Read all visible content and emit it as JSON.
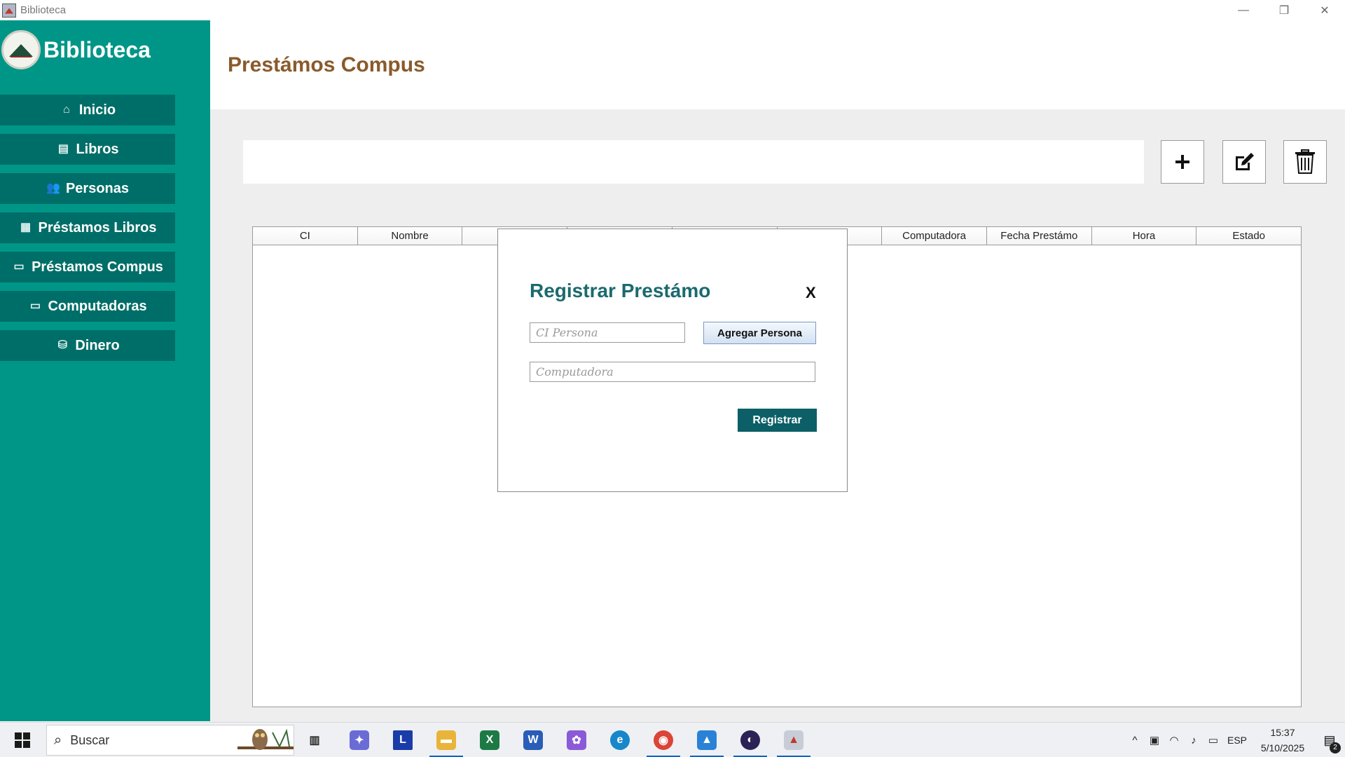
{
  "window": {
    "title": "Biblioteca",
    "minimize": "—",
    "maximize": "❐",
    "close": "✕"
  },
  "sidebar": {
    "brand": "Biblioteca",
    "items": [
      {
        "label": "Inicio",
        "icon": "⌂"
      },
      {
        "label": "Libros",
        "icon": "▤"
      },
      {
        "label": "Personas",
        "icon": "👥"
      },
      {
        "label": "Préstamos Libros",
        "icon": "▦"
      },
      {
        "label": "Préstamos Compus",
        "icon": "▭"
      },
      {
        "label": "Computadoras",
        "icon": "▭"
      },
      {
        "label": "Dinero",
        "icon": "⛁"
      }
    ]
  },
  "header": {
    "title": "Prestámos Compus"
  },
  "toolbar": {
    "search_value": "",
    "add": "+"
  },
  "table": {
    "columns": [
      "CI",
      "Nombre",
      "",
      "",
      "",
      "",
      "Computadora",
      "Fecha Prestámo",
      "Hora",
      "Estado"
    ]
  },
  "modal": {
    "title": "Registrar Prestámo",
    "close": "X",
    "ci_placeholder": "CI Persona",
    "ci_value": "",
    "computer_placeholder": "Computadora",
    "computer_value": "",
    "add_person": "Agregar Persona",
    "submit": "Registrar"
  },
  "taskbar": {
    "search_label": "Buscar",
    "search_icon": "⌕",
    "apps": [
      {
        "name": "task-view",
        "glyph": "▥",
        "color": "#2a2a2a",
        "bg": "transparent"
      },
      {
        "name": "copilot",
        "glyph": "✦",
        "color": "#ffffff",
        "bg": "#6b6bd6"
      },
      {
        "name": "launcher-l",
        "glyph": "L",
        "color": "#ffffff",
        "bg": "#1a3ca8"
      },
      {
        "name": "file-explorer",
        "glyph": "▬",
        "color": "#ffffff",
        "bg": "#e8b43a"
      },
      {
        "name": "excel",
        "glyph": "X",
        "color": "#ffffff",
        "bg": "#1d7a45"
      },
      {
        "name": "word",
        "glyph": "W",
        "color": "#ffffff",
        "bg": "#2a5db8"
      },
      {
        "name": "m365",
        "glyph": "✿",
        "color": "#ffffff",
        "bg": "#8a5ad8"
      },
      {
        "name": "edge",
        "glyph": "e",
        "color": "#ffffff",
        "bg": "#1787c9"
      },
      {
        "name": "chrome",
        "glyph": "◉",
        "color": "#ffffff",
        "bg": "#db4437"
      },
      {
        "name": "photos",
        "glyph": "▲",
        "color": "#ffffff",
        "bg": "#2a82d6"
      },
      {
        "name": "eclipse",
        "glyph": "◐",
        "color": "#ffffff",
        "bg": "#2c2255"
      },
      {
        "name": "java-app",
        "glyph": "▲",
        "color": "#c0392b",
        "bg": "#c8ccd6"
      }
    ],
    "tray": {
      "chevron": "^",
      "lang": "ESP",
      "time": "15:37",
      "date": "5/10/2025",
      "notifications": "2"
    }
  }
}
